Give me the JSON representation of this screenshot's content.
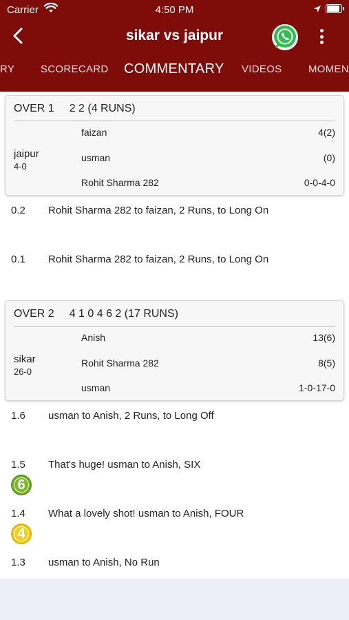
{
  "status": {
    "carrier": "Carrier",
    "time": "4:50 PM"
  },
  "header": {
    "title": "sikar vs jaipur"
  },
  "tabs": [
    "RY",
    "SCORECARD",
    "COMMENTARY",
    "VIDEOS",
    "MOMEN"
  ],
  "overs": [
    {
      "over": "OVER 1",
      "summary": "2 2 (4 RUNS)",
      "team": "jaipur",
      "team_score": "4-0",
      "players": [
        {
          "name": "faizan",
          "stat": "4(2)"
        },
        {
          "name": "usman",
          "stat": "(0)"
        },
        {
          "name": "Rohit Sharma 282",
          "stat": "0-0-4-0"
        }
      ]
    },
    {
      "over": "OVER 2",
      "summary": "4 1 0 4 6 2 (17 RUNS)",
      "team": "sikar",
      "team_score": "26-0",
      "players": [
        {
          "name": "Anish",
          "stat": "13(6)"
        },
        {
          "name": "Rohit Sharma 282",
          "stat": "8(5)"
        },
        {
          "name": "usman",
          "stat": "1-0-17-0"
        }
      ]
    }
  ],
  "balls_over1": [
    {
      "ball": "0.2",
      "text": "Rohit Sharma 282 to faizan, 2 Runs, to Long On"
    },
    {
      "ball": "0.1",
      "text": "Rohit Sharma 282 to faizan, 2 Runs, to Long On"
    }
  ],
  "balls_over2": [
    {
      "ball": "1.6",
      "text": "usman  to Anish, 2 Runs, to Long Off"
    },
    {
      "ball": "1.5",
      "text": "That's huge! usman  to Anish, SIX",
      "badge": "6"
    },
    {
      "ball": "1.4",
      "text": "What a lovely shot! usman  to Anish, FOUR",
      "badge": "4"
    },
    {
      "ball": "1.3",
      "text": "usman  to Anish, No Run"
    }
  ],
  "colors": {
    "header": "#7e0d0a",
    "six": "#7ab72c",
    "four": "#f3cf1c",
    "footer": "#eceff8"
  },
  "icons": [
    "back-arrow-icon",
    "whatsapp-icon",
    "more-vertical-icon",
    "wifi-icon",
    "location-arrow-icon",
    "battery-icon"
  ]
}
